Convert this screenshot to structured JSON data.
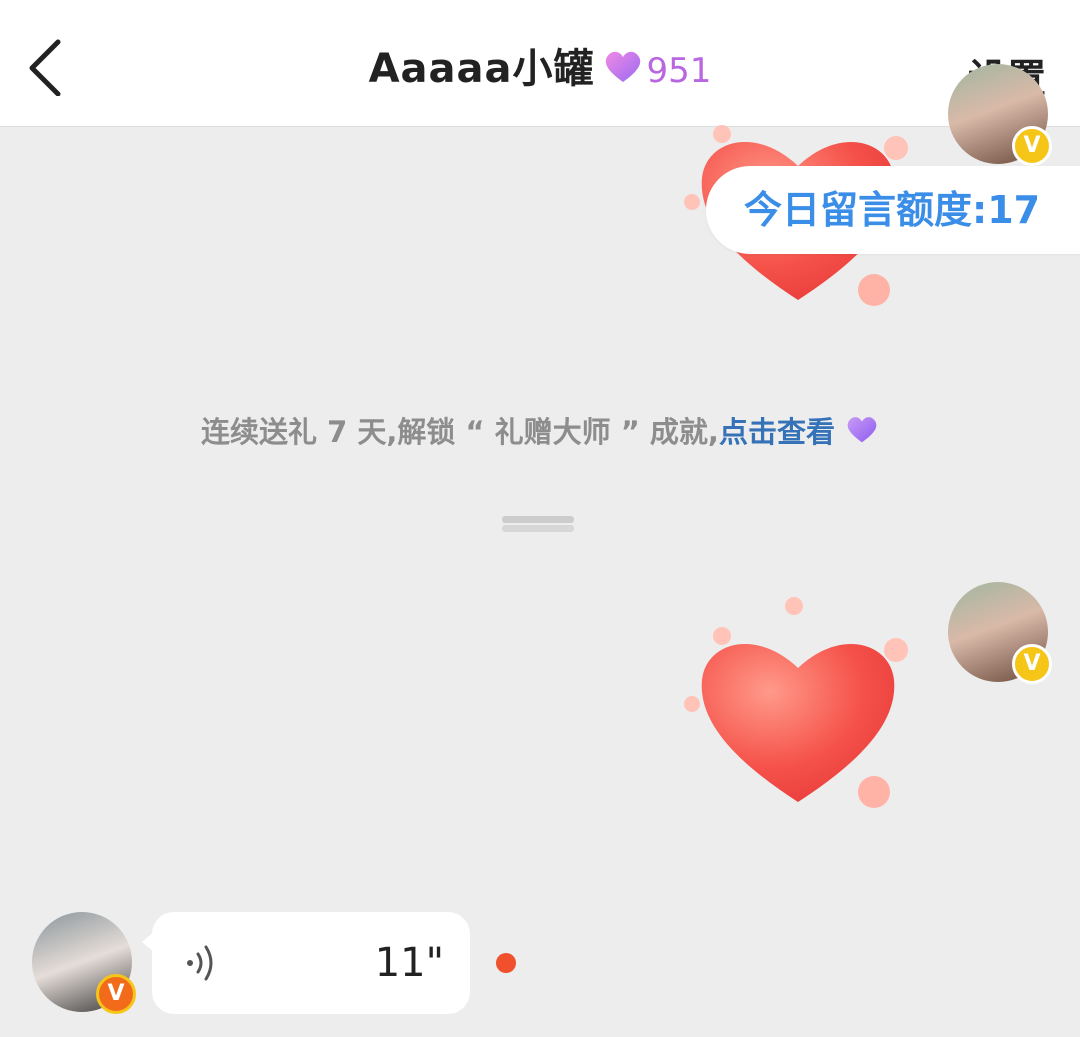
{
  "header": {
    "title": "Aaaaa小罐",
    "intimacy_value": "951",
    "settings_label": "设置",
    "back_icon": "chevron-left-icon"
  },
  "quota": {
    "label": "今日留言额度:17"
  },
  "notice": {
    "text": "连续送礼 7 天,解锁 “ 礼赠大师 ” 成就,",
    "link": "点击查看"
  },
  "voice_message": {
    "duration": "11\"",
    "unread": true
  },
  "colors": {
    "accent_blue": "#3a8ee8",
    "link_blue": "#3572b8",
    "intimacy_purple": "#b867e0",
    "unread_red": "#f0502b",
    "badge_yellow": "#f5c518"
  }
}
